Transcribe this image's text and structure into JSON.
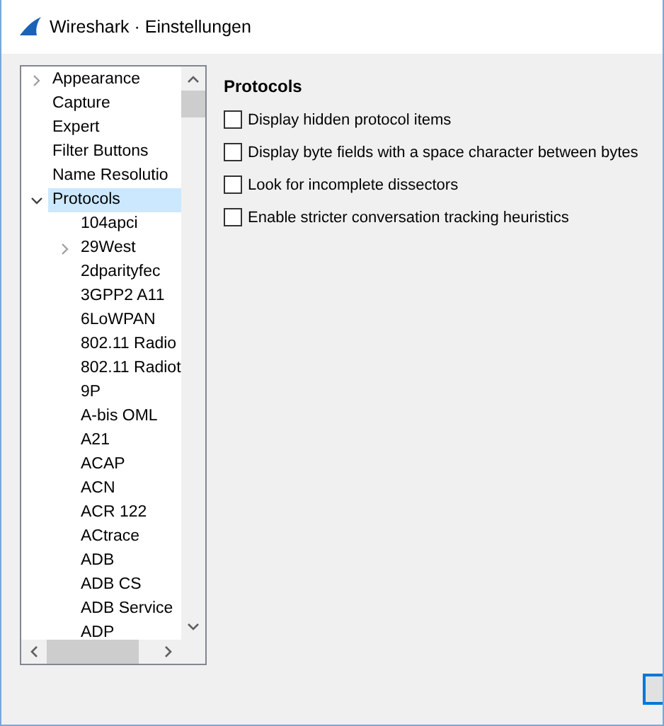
{
  "window": {
    "title": "Wireshark · Einstellungen"
  },
  "sidebar": {
    "items": [
      {
        "label": "Appearance",
        "expanded": false,
        "selected": false
      },
      {
        "label": "Capture",
        "selected": false
      },
      {
        "label": "Expert",
        "selected": false
      },
      {
        "label": "Filter Buttons",
        "selected": false
      },
      {
        "label": "Name Resolutio",
        "selected": false
      },
      {
        "label": "Protocols",
        "expanded": true,
        "selected": true,
        "children": [
          {
            "label": "104apci",
            "selected": false
          },
          {
            "label": "29West",
            "expanded": false,
            "selected": false
          },
          {
            "label": "2dparityfec",
            "selected": false
          },
          {
            "label": "3GPP2 A11",
            "selected": false
          },
          {
            "label": "6LoWPAN",
            "selected": false
          },
          {
            "label": "802.11 Radio",
            "selected": false
          },
          {
            "label": "802.11 Radiot",
            "selected": false
          },
          {
            "label": "9P",
            "selected": false
          },
          {
            "label": "A-bis OML",
            "selected": false
          },
          {
            "label": "A21",
            "selected": false
          },
          {
            "label": "ACAP",
            "selected": false
          },
          {
            "label": "ACN",
            "selected": false
          },
          {
            "label": "ACR 122",
            "selected": false
          },
          {
            "label": "ACtrace",
            "selected": false
          },
          {
            "label": "ADB",
            "selected": false
          },
          {
            "label": "ADB CS",
            "selected": false
          },
          {
            "label": "ADB Service",
            "selected": false
          },
          {
            "label": "ADP",
            "selected": false
          }
        ]
      }
    ]
  },
  "page": {
    "heading": "Protocols",
    "options": [
      {
        "label": "Display hidden protocol items",
        "checked": false
      },
      {
        "label": "Display byte fields with a space character between bytes",
        "checked": false
      },
      {
        "label": "Look for incomplete dissectors",
        "checked": false
      },
      {
        "label": "Enable stricter conversation tracking heuristics",
        "checked": false
      }
    ]
  }
}
